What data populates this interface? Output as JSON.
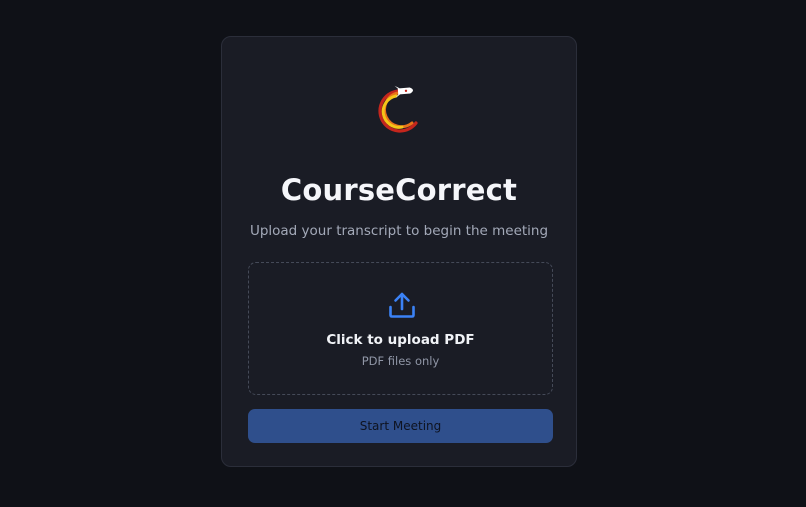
{
  "app": {
    "title": "CourseCorrect",
    "subtitle": "Upload your transcript to begin the meeting"
  },
  "logo": {
    "icon": "rocket-arc-logo",
    "colors": [
      "#f5c518",
      "#e8731a",
      "#c4261d",
      "#ffffff"
    ]
  },
  "upload": {
    "icon": "upload-icon",
    "title": "Click to upload PDF",
    "hint": "PDF files only",
    "accent_color": "#3b82f6"
  },
  "actions": {
    "start_label": "Start Meeting",
    "start_enabled": false,
    "button_color": "#2f4f8c"
  }
}
